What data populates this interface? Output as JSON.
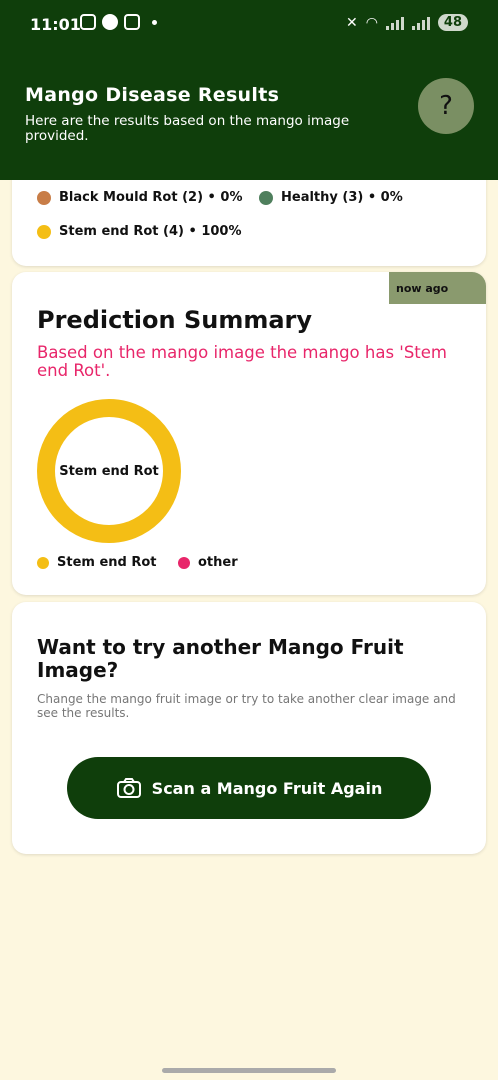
{
  "status": {
    "time": "11:01",
    "battery": "48"
  },
  "header": {
    "title": "Mango Disease Results",
    "subtitle": "Here are the results based on the mango image provided.",
    "help_label": "?"
  },
  "results_legend": {
    "items": [
      {
        "label": "Black Mould Rot (2) • 0%",
        "color": "#c87d47"
      },
      {
        "label": "Healthy (3) • 0%",
        "color": "#4f7f5d"
      },
      {
        "label": "Stem end Rot (4) • 100%",
        "color": "#f4be15"
      }
    ]
  },
  "prediction": {
    "tag": "now ago",
    "title": "Prediction Summary",
    "text": "Based on the mango image the mango has 'Stem end Rot'.",
    "donut_label": "Stem end Rot",
    "donut_share": 1.0,
    "donut_color": "#f4be15",
    "legend": [
      {
        "label": "Stem end Rot",
        "color": "#f4be15"
      },
      {
        "label": "other",
        "color": "#e8266a"
      }
    ]
  },
  "retry": {
    "title": "Want to try another Mango Fruit Image?",
    "subtitle": "Change the mango fruit image or try to take another clear image and see the results.",
    "button_label": "Scan a Mango Fruit Again",
    "button_icon": "camera-icon"
  }
}
